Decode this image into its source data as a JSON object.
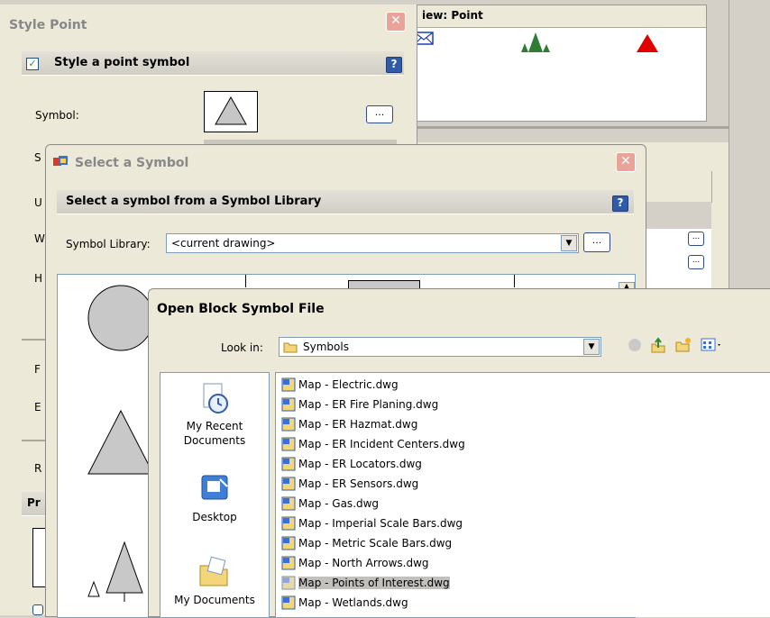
{
  "background": {
    "header_title": "iew: Point"
  },
  "style_point": {
    "title": "Style Point",
    "section_label": "Style a point symbol",
    "symbol_label": "Symbol:",
    "ellipsis": "...",
    "letter_s": "S",
    "letter_u": "U",
    "letter_w": "W",
    "letter_h": "H",
    "letter_f": "F",
    "letter_e": "E",
    "letter_r": "R",
    "letter_pr": "Pr",
    "checked": true
  },
  "select_symbol": {
    "title": "Select a Symbol",
    "section_label": "Select a symbol from a Symbol Library",
    "library_label": "Symbol Library:",
    "library_value": "<current drawing>",
    "ellipsis": "..."
  },
  "open_block": {
    "title": "Open Block Symbol File",
    "look_in_label": "Look in:",
    "look_in_value": "Symbols",
    "places": [
      {
        "label": "My Recent Documents"
      },
      {
        "label": "Desktop"
      },
      {
        "label": "My Documents"
      }
    ],
    "files": [
      "Map - Electric.dwg",
      "Map - ER Fire Planing.dwg",
      "Map - ER Hazmat.dwg",
      "Map - ER Incident Centers.dwg",
      "Map - ER Locators.dwg",
      "Map - ER Sensors.dwg",
      "Map - Gas.dwg",
      "Map - Imperial Scale Bars.dwg",
      "Map - Metric Scale Bars.dwg",
      "Map - North Arrows.dwg",
      "Map - Points of Interest.dwg",
      "Map - Wetlands.dwg"
    ],
    "selected_file": "Map - Points of Interest.dwg"
  }
}
